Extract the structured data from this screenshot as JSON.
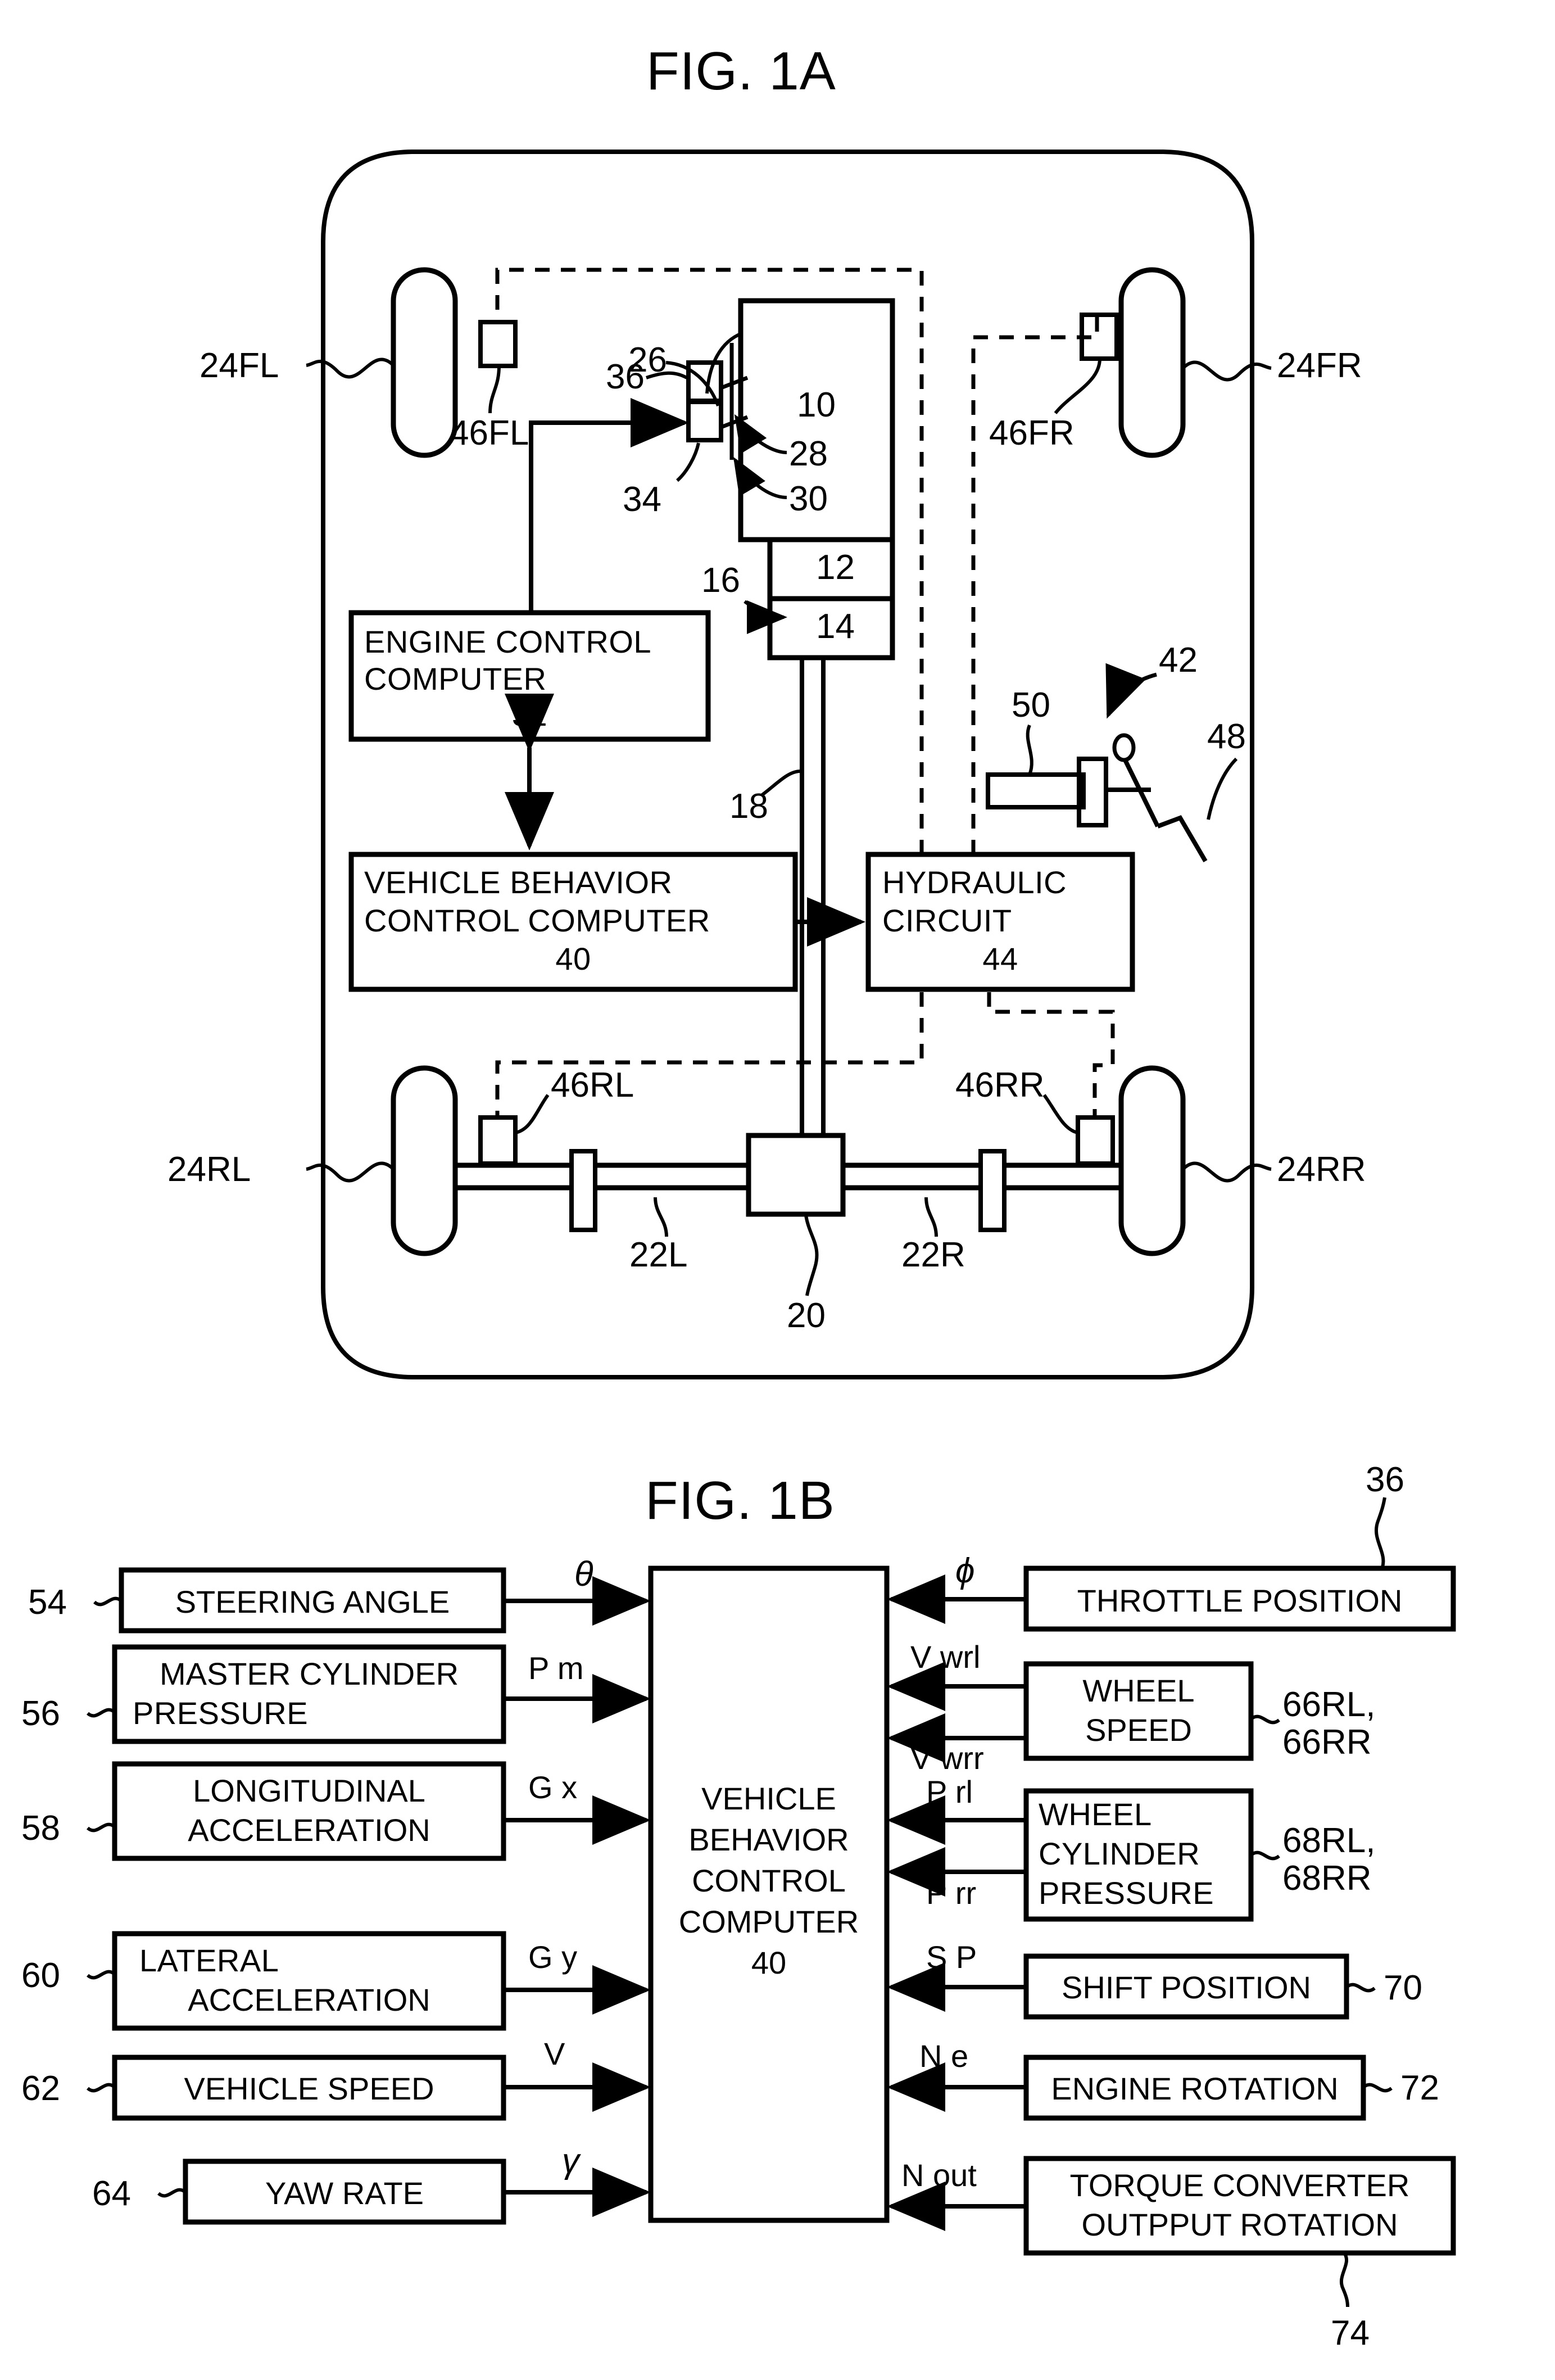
{
  "figures": {
    "fig1a": {
      "title": "FIG. 1A",
      "components": {
        "engine": "10",
        "transmission": "12",
        "torque_converter": "14",
        "output_shaft": "16",
        "propeller_shaft": "18",
        "differential": "20",
        "half_shaft_left": "22L",
        "half_shaft_right": "22R",
        "wheel_fl": "24FL",
        "wheel_fr": "24FR",
        "wheel_rl": "24RL",
        "wheel_rr": "24RR",
        "throttle_linkage": "26",
        "throttle_valve_upper": "28",
        "throttle_valve_lower": "30",
        "actuator": "34",
        "throttle_sensor": "36",
        "brake_system": "42",
        "brake_pedal": "48",
        "master_cylinder": "50",
        "wheel_cyl_fl": "46FL",
        "wheel_cyl_fr": "46FR",
        "wheel_cyl_rl": "46RL",
        "wheel_cyl_rr": "46RR"
      },
      "boxes": {
        "engine_control": {
          "line1": "ENGINE CONTROL",
          "line2": "COMPUTER",
          "ref": "32"
        },
        "vehicle_behavior": {
          "line1": "VEHICLE BEHAVIOR",
          "line2": "CONTROL COMPUTER",
          "ref": "40"
        },
        "hydraulic": {
          "line1": "HYDRAULIC",
          "line2": "CIRCUIT",
          "ref": "44"
        }
      }
    },
    "fig1b": {
      "title": "FIG. 1B",
      "center": {
        "lines": [
          "VEHICLE",
          "BEHAVIOR",
          "CONTROL",
          "COMPUTER"
        ],
        "ref": "40"
      },
      "throttle_ref": "36",
      "left_inputs": [
        {
          "ref": "54",
          "label": "STEERING ANGLE",
          "signal": "θ",
          "lines": [
            "STEERING ANGLE"
          ]
        },
        {
          "ref": "56",
          "label": "MASTER CYLINDER PRESSURE",
          "signal": "P m",
          "lines": [
            "MASTER CYLINDER",
            "PRESSURE"
          ]
        },
        {
          "ref": "58",
          "label": "LONGITUDINAL ACCELERATION",
          "signal": "G x",
          "lines": [
            "LONGITUDINAL",
            "ACCELERATION"
          ]
        },
        {
          "ref": "60",
          "label": "LATERAL ACCELERATION",
          "signal": "G y",
          "lines": [
            "LATERAL",
            "ACCELERATION"
          ]
        },
        {
          "ref": "62",
          "label": "VEHICLE SPEED",
          "signal": "V",
          "lines": [
            "VEHICLE SPEED"
          ]
        },
        {
          "ref": "64",
          "label": "YAW RATE",
          "signal": "γ",
          "lines": [
            "YAW RATE"
          ]
        }
      ],
      "right_inputs": [
        {
          "ref": "36",
          "label": "THROTTLE POSITION",
          "signals": [
            "ϕ"
          ],
          "lines": [
            "THROTTLE POSITION"
          ]
        },
        {
          "ref": "66RL,\n66RR",
          "label": "WHEEL SPEED",
          "signals": [
            "V wrl",
            "V wrr"
          ],
          "lines": [
            "WHEEL",
            "SPEED"
          ]
        },
        {
          "ref": "68RL,\n68RR",
          "label": "WHEEL CYLINDER PRESSURE",
          "signals": [
            "P rl",
            "P rr"
          ],
          "lines": [
            "WHEEL",
            "CYLINDER",
            "PRESSURE"
          ]
        },
        {
          "ref": "70",
          "label": "SHIFT POSITION",
          "signals": [
            "S P"
          ],
          "lines": [
            "SHIFT POSITION"
          ]
        },
        {
          "ref": "72",
          "label": "ENGINE ROTATION",
          "signals": [
            "N e"
          ],
          "lines": [
            "ENGINE ROTATION"
          ]
        },
        {
          "ref": "74",
          "label": "TORQUE CONVERTER OUTPPUT ROTATION",
          "signals": [
            "N out"
          ],
          "lines": [
            "TORQUE CONVERTER",
            "OUTPPUT ROTATION"
          ]
        }
      ]
    }
  },
  "colors": {
    "ink": "#000000",
    "paper": "#ffffff"
  }
}
